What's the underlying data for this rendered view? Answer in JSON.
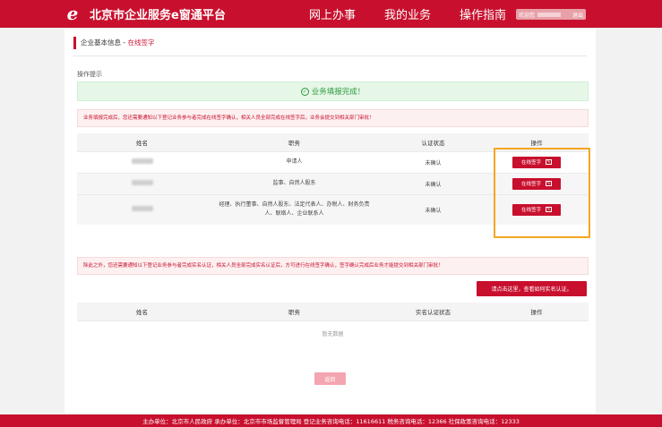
{
  "header": {
    "logo_glyph": "e",
    "title": "北京市企业服务e窗通平台",
    "nav": [
      "网上办事",
      "我的业务",
      "操作指南"
    ],
    "user": {
      "greeting": "欢迎您",
      "logout": "退出"
    }
  },
  "breadcrumb": {
    "parent": "企业基本信息",
    "separator": " - ",
    "current": "在线签字"
  },
  "tip_title": "操作提示",
  "success_message": "业务填报完成！",
  "sign_notice": "业务填报完成后，您还需要通知以下登记业务参与者完成在线签字确认，相关人员全部完成在线签字后，业务会提交到相关部门审批！",
  "sign_table": {
    "headers": [
      "姓名",
      "职务",
      "认证状态",
      "操作"
    ],
    "rows": [
      {
        "roles": "申请人",
        "status": "未确认",
        "action": "在线签字"
      },
      {
        "roles": "监事、自然人股东",
        "status": "未确认",
        "action": "在线签字"
      },
      {
        "roles": "经理、执行董事、自然人股东、法定代表人、办税人、财务负责人、联络人、企业联系人",
        "status": "未确认",
        "action": "在线签字"
      }
    ]
  },
  "realname_notice": "除此之外，您还需要通知以下登记业务参与者完成实名认证，相关人员全部完成实名认证后，方可进行在线签字确认，签字确认完成后业务才能提交到相关部门审批！",
  "realname_button": "请点击这里，查看如何实名认证。",
  "realname_table": {
    "headers": [
      "姓名",
      "职务",
      "实名认证状态",
      "操作"
    ],
    "empty": "暂无数据"
  },
  "back_button": "返回",
  "footer": "主办单位：北京市人民政府 承办单位：北京市市场监督管理局 登记业务咨询电话：11616611 税务咨询电话：12366 社保政策咨询电话：12333",
  "colors": {
    "brand": "#c8102e",
    "success": "#2e9a3e",
    "highlight": "#f5a623"
  }
}
